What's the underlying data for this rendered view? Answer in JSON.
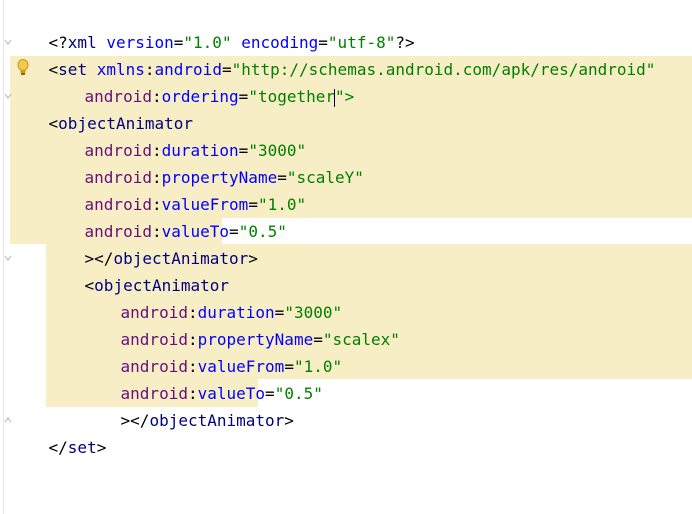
{
  "editor": {
    "lines": [
      [
        "<?",
        "xml",
        " version",
        "=",
        "\"1.0\"",
        " encoding",
        "=",
        "\"utf-8\"",
        "?>"
      ],
      [
        "<",
        "set",
        " xmlns",
        ":",
        "android",
        "=",
        "\"http://schemas.android.com/apk/res/android\""
      ],
      [
        "android",
        ":",
        "ordering",
        "=",
        "\"together",
        "\">"
      ],
      [
        "<",
        "objectAnimator"
      ],
      [
        "android",
        ":",
        "duration",
        "=",
        "\"3000\""
      ],
      [
        "android",
        ":",
        "propertyName",
        "=",
        "\"scaleY\""
      ],
      [
        "android",
        ":",
        "valueFrom",
        "=",
        "\"1.0\""
      ],
      [
        "android",
        ":",
        "valueTo",
        "=",
        "\"0.5\""
      ],
      [
        ">",
        "</",
        "objectAnimator",
        ">"
      ],
      [
        "<",
        "objectAnimator"
      ],
      [
        "android",
        ":",
        "duration",
        "=",
        "\"3000\""
      ],
      [
        "android",
        ":",
        "propertyName",
        "=",
        "\"scalex\""
      ],
      [
        "android",
        ":",
        "valueFrom",
        "=",
        "\"1.0\""
      ],
      [
        "android",
        ":",
        "valueTo",
        "=",
        "\"0.5\""
      ],
      [
        ">",
        "</",
        "objectAnimator",
        ">"
      ],
      [
        "</",
        "set",
        ">"
      ]
    ]
  },
  "colors": {
    "highlight": "#f8eec5",
    "namespace": "#660e7a",
    "attribute": "#0000ff",
    "string": "#008000",
    "tag": "#000080"
  },
  "icons": {
    "intention": "lightbulb-icon",
    "fold": "fold-marker-icon"
  }
}
